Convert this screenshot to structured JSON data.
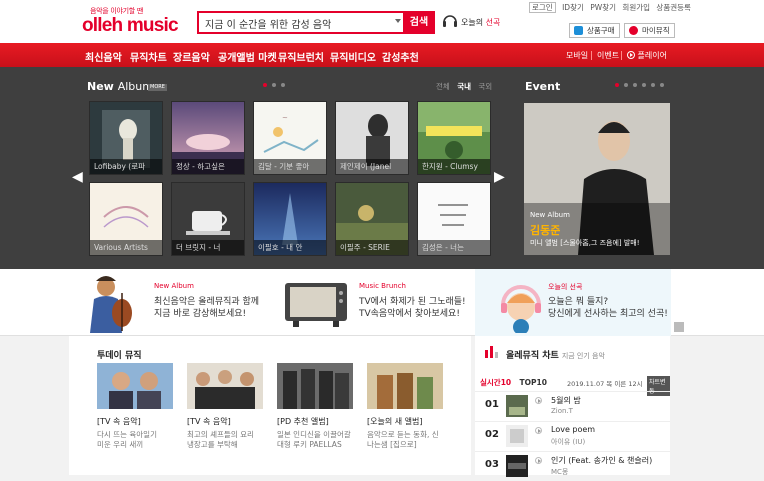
{
  "header": {
    "tagline": "음악을 이야기할 땐",
    "logo": "olleh music",
    "search_value": "지금 이 순간을 위한 감성 음악",
    "search_button": "검색",
    "pick_label": "오늘의",
    "pick_accent": "선곡",
    "toplinks": {
      "login": "로그인",
      "find_id": "ID찾기",
      "find_pw": "PW찾기",
      "join": "회원가입",
      "register": "상품권등록"
    },
    "buy_button": "상품구매",
    "my_button": "마이뮤직"
  },
  "nav": {
    "items": [
      "최신음악",
      "뮤직차트",
      "장르음악",
      "공개앨범 마켓",
      "뮤직브런치",
      "뮤직비디오",
      "감성추천"
    ],
    "mobile": "모바일",
    "event": "이벤트",
    "player": "플레이어"
  },
  "new_album": {
    "title": "New",
    "title2": "Album",
    "more": "MORE",
    "filters": [
      "전체",
      "국내",
      "국외"
    ],
    "albums": [
      {
        "caption": "Lofibaby (로파"
      },
      {
        "caption": "정상 - 하고싶은"
      },
      {
        "caption": "김달 - 기분 좋아"
      },
      {
        "caption": "제인제이 (Janel"
      },
      {
        "caption": "한지원 - Clumsy"
      },
      {
        "caption": "Various Artists"
      },
      {
        "caption": "더 브릿지 - 너"
      },
      {
        "caption": "이필호 - 내 안"
      },
      {
        "caption": "이필주 - SERIE"
      },
      {
        "caption": "김성은 - 너는"
      }
    ]
  },
  "event": {
    "title": "Event",
    "label": "New Album",
    "artist": "김동준",
    "desc": "미니 앨범 [스물아홉,그 즈음에] 발매!"
  },
  "promo": [
    {
      "title": "New Album",
      "line1": "최신음악은 올레뮤직과 함께",
      "line2": "지금 바로 감상해보세요!"
    },
    {
      "title": "Music Brunch",
      "line1": "TV에서 화제가 된 그노래들!",
      "line2": "TV속음악에서 찾아보세요!"
    },
    {
      "title": "오늘의 선곡",
      "line1": "오늘은 뭐 들지?",
      "line2": "당신에게 선사하는 최고의 선곡!"
    }
  ],
  "today": {
    "title": "투데이 뮤직",
    "cards": [
      {
        "tag": "[TV 속 음악]",
        "line1": "다시 뜨는 육아일기",
        "line2": "미운 우리 새끼"
      },
      {
        "tag": "[TV 속 음악]",
        "line1": "최고의 셰프들의 요리",
        "line2": "냉장고를 부탁해"
      },
      {
        "tag": "[PD 추천 앨범]",
        "line1": "일본 인디신을 이끌어갈",
        "line2": "대형 루키 PAELLAS"
      },
      {
        "tag": "[오늘의 새 앨범]",
        "line1": "음악으로 듣는 동화, 신",
        "line2": "나는샘 [집으로]"
      }
    ]
  },
  "chart": {
    "title": "올레뮤직 차트",
    "subtitle": "지금 인기 음악",
    "tab_live": "실시간10",
    "tab_top": "TOP10",
    "date": "2019.11.07 목 이른 12시",
    "tag": "차트변동",
    "rows": [
      {
        "rank": "01",
        "title": "5월의 밤",
        "artist": "Zion.T"
      },
      {
        "rank": "02",
        "title": "Love poem",
        "artist": "아이유 (IU)"
      },
      {
        "rank": "03",
        "title": "인기 (Feat. 송가인 & 챈슬러)",
        "artist": "MC몽"
      }
    ]
  }
}
